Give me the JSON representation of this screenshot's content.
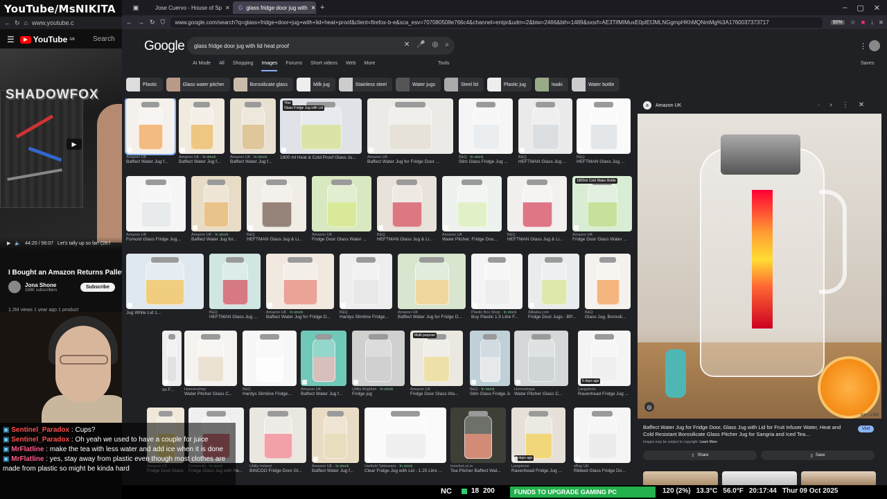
{
  "youtube": {
    "overlay_title": "YouTube/MsNIKITA",
    "url": "www.youtube.c",
    "logo_text": "YouTube",
    "logo_sup": "GB",
    "search_label": "Search",
    "video_wall_text": "SHADOWFOX",
    "time": "44:20 / 56:07",
    "progress_caption": "Let's tally up so far! (28:f",
    "video_title": "I Bought an Amazon Returns Pallet fo",
    "channel": "Jona Shone",
    "subscribers": "169K subscribers",
    "subscribe": "Subscribe",
    "views": "1.2M views 1 year ago 1 product"
  },
  "chat": [
    {
      "user": "Sentinel_Paradox",
      "text": "Cups?"
    },
    {
      "user": "Sentinel_Paradox",
      "text": "Oh yeah we used to have a couple for juice"
    },
    {
      "user": "MrFlatline",
      "text": "make the tea with less water and add ice when it is done"
    },
    {
      "user": "MrFlatline",
      "text": "yes, stay away from plastic even though most clothes are made from plastic so might be kinda hard"
    }
  ],
  "browser": {
    "tabs": [
      {
        "label": "Jose Cuervo - House of Sp"
      },
      {
        "label": "glass fridge door jug with"
      }
    ],
    "url": "www.google.com/search?q=glass+fridge+door+jug+with+lid+heat+proof&client=firefox-b-e&sca_esv=707080508e766c4&channel=entpr&udm=2&biw=2466&bih=1489&sxsrf=AE3TifMIMuxE0pIEfJMLNGgmpHKhMQNmMg%3A1760037373717",
    "zoom": "90%"
  },
  "google": {
    "logo": "Google",
    "query": "glass fridge door jug with lid heat proof",
    "tabs": [
      "AI Mode",
      "All",
      "Shopping",
      "Images",
      "Forums",
      "Short videos",
      "Web",
      "More"
    ],
    "tools": "Tools",
    "saves": "Saves",
    "chips": [
      "Plastic",
      "Glass water pitcher",
      "Borosilicate glass",
      "Milk jug",
      "Stainless steel",
      "Water jugs",
      "Steel lid",
      "Plastic jug",
      "Iwaki",
      "Water bottle"
    ]
  },
  "results": [
    {
      "src": "Amazon UK",
      "stock": "",
      "cap": "Baffect Water Jug f..."
    },
    {
      "src": "Amazon UK",
      "stock": "In stock",
      "cap": "Baffect Water Jug f..."
    },
    {
      "src": "Amazon UK",
      "stock": "In stock",
      "cap": "Baffect Water Jug f..."
    },
    {
      "src": "",
      "stock": "",
      "cap": "1800 ml Heat & Cold Proof Glass Ju..."
    },
    {
      "src": "Amazon UK",
      "stock": "",
      "cap": "Baffect Water Jug for Fridge Door ..."
    },
    {
      "src": "B&Q",
      "stock": "In stock",
      "cap": "Slim Glass Fridge Jug ..."
    },
    {
      "src": "B&Q",
      "stock": "",
      "cap": "HEFTMAN Glass Jug ..."
    },
    {
      "src": "B&Q",
      "stock": "",
      "cap": "HEFTMAN Glass Jug ..."
    },
    {
      "src": "Amazon UK",
      "stock": "",
      "cap": "Fomord Glass Fridge Jug..."
    },
    {
      "src": "Amazon UK",
      "stock": "In stock",
      "cap": "Baffect Water Jug for..."
    },
    {
      "src": "B&Q",
      "stock": "",
      "cap": "HEFTMAN Glass Jug & Li..."
    },
    {
      "src": "Amazon UK",
      "stock": "",
      "cap": "Fridge Door Glass Water ..."
    },
    {
      "src": "B&Q",
      "stock": "",
      "cap": "HEFTMAN Glass Jug & Li..."
    },
    {
      "src": "Amazon UK",
      "stock": "",
      "cap": "Water Pitcher, Fridge Doo..."
    },
    {
      "src": "B&Q",
      "stock": "",
      "cap": "HEFTMAN Glass Jug & Li..."
    },
    {
      "src": "Amazon UK",
      "stock": "",
      "cap": "Fridge Door Glass Water ..."
    },
    {
      "src": "",
      "stock": "",
      "cap": "Jug White Lid 1..."
    },
    {
      "src": "B&Q",
      "stock": "",
      "cap": "HEFTMAN Glass Jug ..."
    },
    {
      "src": "Amazon UK",
      "stock": "In stock",
      "cap": "Baffect Water Jug for Fridge D..."
    },
    {
      "src": "B&Q",
      "stock": "",
      "cap": "Hardys Slimline Fridge..."
    },
    {
      "src": "Amazon UK",
      "stock": "",
      "cap": "Baffect Water Jug for Fridge D..."
    },
    {
      "src": "Plastic Box Shop",
      "stock": "In stock",
      "cap": "Buy Plastic 1.5 Litre F..."
    },
    {
      "src": "Alibaba.com",
      "stock": "",
      "cap": "Fridge Door Jugs - BP..."
    },
    {
      "src": "B&Q",
      "stock": "",
      "cap": "Glass Jug, Borosili..."
    },
    {
      "src": "",
      "stock": "",
      "cap": "ss F..."
    },
    {
      "src": "Hoimenshop",
      "stock": "",
      "cap": "Water Pitcher Glass C..."
    },
    {
      "src": "B&Q",
      "stock": "",
      "cap": "Hardys Slimline Fridge..."
    },
    {
      "src": "Amazon UK",
      "stock": "",
      "cap": "Baffect Water Jug f..."
    },
    {
      "src": "Utility Brighton",
      "stock": "In stock",
      "cap": "Fridge jug"
    },
    {
      "src": "Amazon UK",
      "stock": "",
      "cap": "Fridge Door Glass Wa..."
    },
    {
      "src": "B&Q",
      "stock": "In stock",
      "cap": "Slim Glass Fridge Jug..."
    },
    {
      "src": "Homeshopa",
      "stock": "",
      "cap": "Water Pitcher Glass C..."
    },
    {
      "src": "Langstone",
      "stock": "",
      "cap": "Ravenhead Fridge Jug ..."
    },
    {
      "src": "Amazon UK",
      "stock": "",
      "cap": "Fridge Door Glass Wate..."
    },
    {
      "src": "Cookeville",
      "stock": "In stock",
      "cap": "Fridge Glass Jug with Re..."
    },
    {
      "src": "Utility Ireland",
      "stock": "",
      "cap": "BINCOO Fridge Door Gl..."
    },
    {
      "src": "Amazon UK",
      "stock": "In stock",
      "cap": "Baffect Water Jug f..."
    },
    {
      "src": "Harfield Tableware",
      "stock": "In stock",
      "cap": "Clear Fridge Jug with Lid - 1.25 Litre ..."
    },
    {
      "src": "Inewhot.co.in",
      "stock": "",
      "cap": "Tea Pitcher Baffect Wat..."
    },
    {
      "src": "Langstone",
      "stock": "",
      "cap": "Ravenhead Fridge Jug ..."
    },
    {
      "src": "eBay UK",
      "stock": "",
      "cap": "Ribbed Glass Fridge Do..."
    }
  ],
  "badges": {
    "cold": "1800ml Cold Water Bottle",
    "multi": "Multi purpose",
    "days1": "6 days ago",
    "days2": "6 days ago",
    "yiter": "Yiter",
    "yiter_sub": "Glass Fridge Jug with Lid",
    "dim": "600 × 1,500"
  },
  "panel": {
    "source": "Amazon UK",
    "caption": "Baffect Water Jug for Fridge Door, Glass Jug with Lid for Fruit Infuser Water, Heat and Cold Resistant Borosilicate Glass Pitcher Jug for Sangria and Iced Tea...",
    "copyright": "Images may be subject to copyright.",
    "learn_more": "Learn More",
    "visit": "Visit",
    "share": "Share",
    "save": "Save"
  },
  "taskbar": {
    "nc": "NC",
    "sub_count": "18",
    "sub_goal": "200",
    "goal_text": "FUNDS TO UPGRADE GAMING PC",
    "cpu": "120 (2%)",
    "temp_c": "13.3°C",
    "temp_f": "56.0°F",
    "clock": "20:17:44",
    "date": "Thur 09 Oct 2025"
  }
}
